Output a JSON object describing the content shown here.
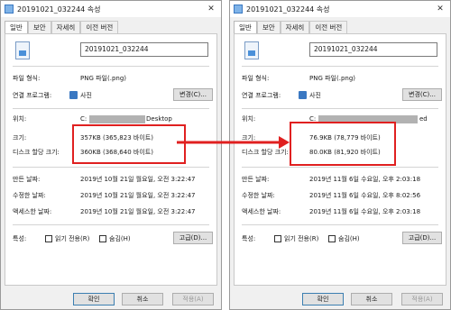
{
  "left": {
    "window_title": "20191021_032244 속성",
    "tabs": [
      "일반",
      "보안",
      "자세히",
      "이전 버전"
    ],
    "file_name": "20191021_032244",
    "labels": {
      "file_type": "파일 형식:",
      "open_with": "연결 프로그램:",
      "location": "위치:",
      "size": "크기:",
      "size_on_disk": "디스크 할당 크기:",
      "created": "만든 날짜:",
      "modified": "수정한 날짜:",
      "accessed": "액세스한 날짜:",
      "attributes": "특성:"
    },
    "file_type": "PNG 파일(.png)",
    "open_with": "사진",
    "change_button": "변경(C)...",
    "location_prefix": "C:",
    "location_suffix": "Desktop",
    "size": "357KB (365,823 바이트)",
    "size_on_disk": "360KB (368,640 바이트)",
    "created": "2019년 10월 21일 월요일, 오전 3:22:47",
    "modified": "2019년 10월 21일 월요일, 오전 3:22:47",
    "accessed": "2019년 10월 21일 월요일, 오전 3:22:47",
    "readonly": "읽기 전용(R)",
    "hidden": "숨김(H)",
    "advanced_button": "고급(D)...",
    "ok_button": "확인",
    "cancel_button": "취소",
    "apply_button": "적용(A)"
  },
  "right": {
    "window_title": "20191021_032244 속성",
    "tabs": [
      "일반",
      "보안",
      "자세히",
      "이전 버전"
    ],
    "file_name": "20191021_032244",
    "labels": {
      "file_type": "파일 형식:",
      "open_with": "연결 프로그램:",
      "location": "위치:",
      "size": "크기:",
      "size_on_disk": "디스크 할당 크기:",
      "created": "만든 날짜:",
      "modified": "수정한 날짜:",
      "accessed": "액세스한 날짜:",
      "attributes": "특성:"
    },
    "file_type": "PNG 파일(.png)",
    "open_with": "사진",
    "change_button": "변경(C)...",
    "location_prefix": "C:",
    "location_suffix": "ed",
    "size": "76.9KB (78,779 바이트)",
    "size_on_disk": "80.0KB (81,920 바이트)",
    "created": "2019년 11월 6일 수요일, 오후 2:03:18",
    "modified": "2019년 11월 6일 수요일, 오후 8:02:56",
    "accessed": "2019년 11월 6일 수요일, 오후 2:03:18",
    "readonly": "읽기 전용(R)",
    "hidden": "숨김(H)",
    "advanced_button": "고급(D)...",
    "ok_button": "확인",
    "cancel_button": "취소",
    "apply_button": "적용(A)"
  },
  "colors": {
    "highlight": "#e02020",
    "dialog_bg": "#f0f0f0",
    "panel_bg": "#ffffff",
    "redaction": "#b2b2b2"
  },
  "icons": {
    "title": "image-file-icon",
    "file": "png-file-icon",
    "app": "photos-app-icon",
    "arrow": "right-arrow-icon"
  }
}
